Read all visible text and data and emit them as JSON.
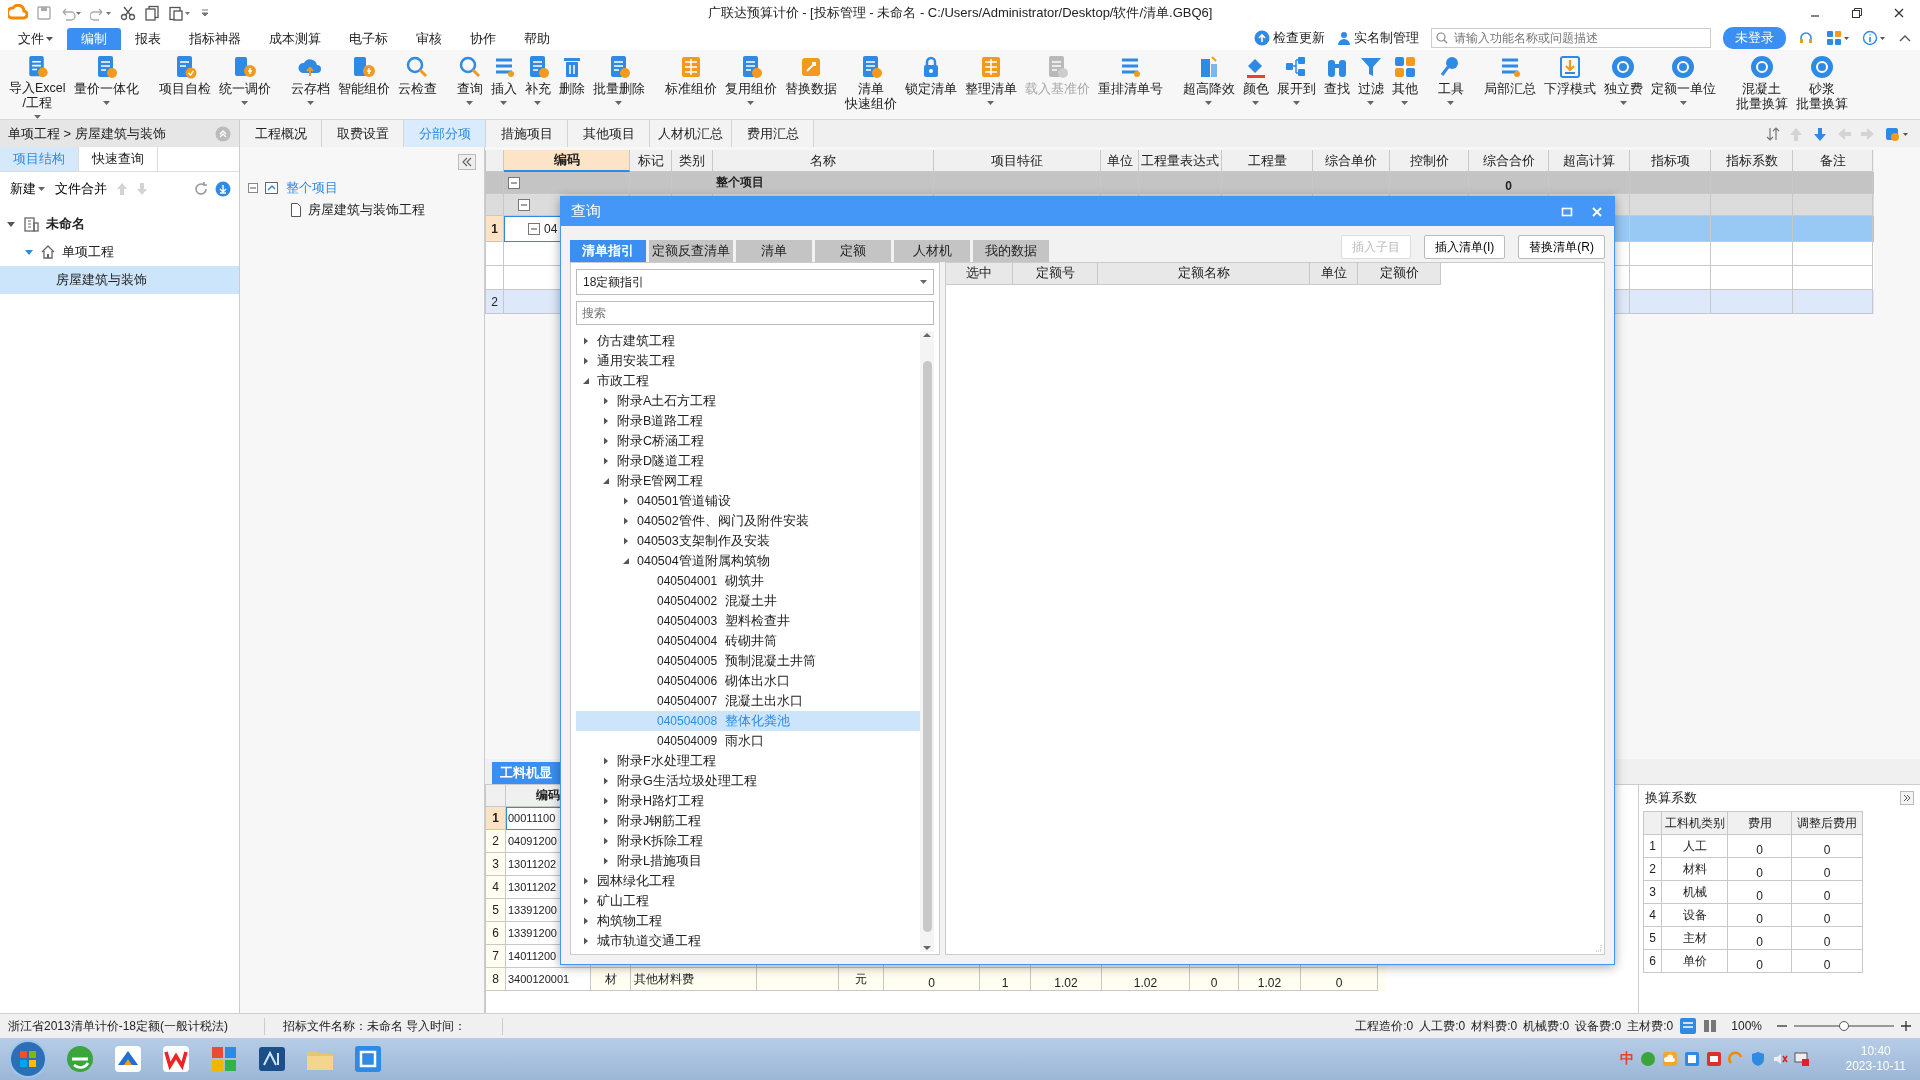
{
  "title_bar": {
    "title": "广联达预算计价 - [投标管理 - 未命名 - C:/Users/Administrator/Desktop/软件/清单.GBQ6]"
  },
  "menu": [
    {
      "label": "文件",
      "dropdown": true,
      "selected": false
    },
    {
      "label": "编制",
      "dropdown": false,
      "selected": true
    },
    {
      "label": "报表",
      "dropdown": false,
      "selected": false
    },
    {
      "label": "指标神器",
      "dropdown": false,
      "selected": false
    },
    {
      "label": "成本测算",
      "dropdown": false,
      "selected": false
    },
    {
      "label": "电子标",
      "dropdown": false,
      "selected": false
    },
    {
      "label": "审核",
      "dropdown": false,
      "selected": false
    },
    {
      "label": "协作",
      "dropdown": false,
      "selected": false
    },
    {
      "label": "帮助",
      "dropdown": false,
      "selected": false
    }
  ],
  "menu_right": {
    "update": "检查更新",
    "realname": "实名制管理",
    "search_placeholder": "请输入功能名称或问题描述",
    "login": "未登录"
  },
  "ribbon": [
    {
      "items": [
        {
          "lines": [
            "导入Excel",
            "/工程"
          ],
          "dropdown": true,
          "disabled": false
        },
        {
          "lines": [
            "量价一体化"
          ],
          "dropdown": true,
          "disabled": false
        }
      ]
    },
    {
      "items": [
        {
          "lines": [
            "项目自检"
          ],
          "dropdown": false,
          "disabled": false
        },
        {
          "lines": [
            "统一调价"
          ],
          "dropdown": true,
          "disabled": false
        }
      ]
    },
    {
      "items": [
        {
          "lines": [
            "云存档"
          ],
          "dropdown": true,
          "disabled": false
        },
        {
          "lines": [
            "智能组价"
          ],
          "dropdown": false,
          "disabled": false
        },
        {
          "lines": [
            "云检查"
          ],
          "dropdown": false,
          "disabled": false
        }
      ]
    },
    {
      "items": [
        {
          "lines": [
            "查询"
          ],
          "dropdown": true,
          "disabled": false
        },
        {
          "lines": [
            "插入"
          ],
          "dropdown": true,
          "disabled": false
        },
        {
          "lines": [
            "补充"
          ],
          "dropdown": true,
          "disabled": false
        },
        {
          "lines": [
            "删除"
          ],
          "dropdown": false,
          "disabled": false
        },
        {
          "lines": [
            "批量删除"
          ],
          "dropdown": true,
          "disabled": false
        }
      ]
    },
    {
      "items": [
        {
          "lines": [
            "标准组价"
          ],
          "dropdown": false,
          "disabled": false
        },
        {
          "lines": [
            "复用组价"
          ],
          "dropdown": true,
          "disabled": false
        },
        {
          "lines": [
            "替换数据"
          ],
          "dropdown": false,
          "disabled": false
        },
        {
          "lines": [
            "清单",
            "快速组价"
          ],
          "dropdown": false,
          "disabled": false
        },
        {
          "lines": [
            "锁定清单"
          ],
          "dropdown": false,
          "disabled": false
        },
        {
          "lines": [
            "整理清单"
          ],
          "dropdown": true,
          "disabled": false
        },
        {
          "lines": [
            "载入基准价"
          ],
          "dropdown": false,
          "disabled": true
        },
        {
          "lines": [
            "重排清单号"
          ],
          "dropdown": false,
          "disabled": false
        }
      ]
    },
    {
      "items": [
        {
          "lines": [
            "超高降效"
          ],
          "dropdown": true,
          "disabled": false
        },
        {
          "lines": [
            "颜色"
          ],
          "dropdown": true,
          "disabled": false
        },
        {
          "lines": [
            "展开到"
          ],
          "dropdown": true,
          "disabled": false
        },
        {
          "lines": [
            "查找"
          ],
          "dropdown": false,
          "disabled": false
        },
        {
          "lines": [
            "过滤"
          ],
          "dropdown": true,
          "disabled": false
        },
        {
          "lines": [
            "其他"
          ],
          "dropdown": true,
          "disabled": false
        }
      ]
    },
    {
      "items": [
        {
          "lines": [
            "工具"
          ],
          "dropdown": true,
          "disabled": false
        }
      ]
    },
    {
      "items": [
        {
          "lines": [
            "局部汇总"
          ],
          "dropdown": false,
          "disabled": false
        },
        {
          "lines": [
            "下浮模式"
          ],
          "dropdown": false,
          "disabled": false
        },
        {
          "lines": [
            "独立费"
          ],
          "dropdown": true,
          "disabled": false
        },
        {
          "lines": [
            "定额一单位"
          ],
          "dropdown": true,
          "disabled": false
        }
      ]
    },
    {
      "items": [
        {
          "lines": [
            "混凝土",
            "批量换算"
          ],
          "dropdown": false,
          "disabled": false
        },
        {
          "lines": [
            "砂浆",
            "批量换算"
          ],
          "dropdown": false,
          "disabled": false
        }
      ]
    }
  ],
  "left_panel": {
    "breadcrumb": "单项工程 > 房屋建筑与装饰",
    "tabs": [
      {
        "label": "项目结构",
        "selected": true
      },
      {
        "label": "快速查询",
        "selected": false
      }
    ],
    "toolbar": {
      "new": "新建",
      "merge": "文件合并"
    },
    "tree": [
      {
        "label": "未命名",
        "expanded": true,
        "children": [
          {
            "label": "单项工程",
            "expanded": true,
            "children": [
              {
                "label": "房屋建筑与装饰",
                "selected": true
              }
            ]
          }
        ]
      }
    ]
  },
  "doc_tabs": [
    {
      "label": "工程概况",
      "selected": false
    },
    {
      "label": "取费设置",
      "selected": false
    },
    {
      "label": "分部分项",
      "selected": true
    },
    {
      "label": "措施项目",
      "selected": false
    },
    {
      "label": "其他项目",
      "selected": false
    },
    {
      "label": "人材机汇总",
      "selected": false
    },
    {
      "label": "费用汇总",
      "selected": false
    }
  ],
  "sub_panel": {
    "tree": [
      {
        "label": "整个项目",
        "expanded": true,
        "children": [
          {
            "label": "房屋建筑与装饰工程"
          }
        ]
      }
    ]
  },
  "main_table": {
    "columns": [
      "编码",
      "标记",
      "类别",
      "名称",
      "项目特征",
      "单位",
      "工程量表达式",
      "工程量",
      "综合单价",
      "控制价",
      "综合合价",
      "超高计算",
      "指标项",
      "指标系数",
      "备注"
    ],
    "rows": [
      {
        "kind": "total",
        "expanded": true,
        "title": "整个项目",
        "amount": "0",
        "selected": false
      },
      {
        "kind": "section",
        "expanded": true,
        "selected": false
      },
      {
        "kind": "item",
        "number": "1",
        "code": "04",
        "expanded": true,
        "selected": true
      },
      {
        "kind": "child",
        "selected": false
      },
      {
        "kind": "child",
        "selected": false
      },
      {
        "kind": "measure",
        "number": "2",
        "selected": false
      }
    ]
  },
  "bottom_panel": {
    "tab": "工料机显",
    "code_header": "编码",
    "rows": [
      {
        "number": "1",
        "code": "00011100",
        "selected": true
      },
      {
        "number": "2",
        "code": "04091200",
        "selected": false
      },
      {
        "number": "3",
        "code": "13011202",
        "selected": false
      },
      {
        "number": "4",
        "code": "13011202",
        "selected": false
      },
      {
        "number": "5",
        "code": "13391200",
        "selected": false
      },
      {
        "number": "6",
        "code": "13391200",
        "selected": false
      },
      {
        "number": "7",
        "code": "14011200",
        "selected": false
      },
      {
        "number": "8",
        "code": "3400120001",
        "type": "材",
        "name": "其他材料费",
        "unit": "元",
        "values": [
          "0",
          "1",
          "1.02",
          "1.02",
          "0",
          "1.02",
          "0"
        ],
        "selected": false
      }
    ]
  },
  "conversion_panel": {
    "title": "换算系数",
    "columns": [
      "工料机类别",
      "费用",
      "调整后费用"
    ],
    "rows": [
      {
        "number": "1",
        "category": "人工",
        "cost": "0",
        "adjusted": "0"
      },
      {
        "number": "2",
        "category": "材料",
        "cost": "0",
        "adjusted": "0"
      },
      {
        "number": "3",
        "category": "机械",
        "cost": "0",
        "adjusted": "0"
      },
      {
        "number": "4",
        "category": "设备",
        "cost": "0",
        "adjusted": "0"
      },
      {
        "number": "5",
        "category": "主材",
        "cost": "0",
        "adjusted": "0"
      },
      {
        "number": "6",
        "category": "单价",
        "cost": "0",
        "adjusted": "0"
      }
    ]
  },
  "dialog": {
    "title": "查询",
    "tabs": [
      {
        "label": "清单指引",
        "selected": true
      },
      {
        "label": "定额反查清单",
        "selected": false
      },
      {
        "label": "清单",
        "selected": false
      },
      {
        "label": "定额",
        "selected": false
      },
      {
        "label": "人材机",
        "selected": false
      },
      {
        "label": "我的数据",
        "selected": false
      }
    ],
    "buttons": [
      {
        "label": "插入子目",
        "disabled": true
      },
      {
        "label": "插入清单(I)",
        "disabled": false
      },
      {
        "label": "替换清单(R)",
        "disabled": false
      }
    ],
    "library": "18定额指引",
    "search_placeholder": "搜索",
    "tree": [
      {
        "label": "仿古建筑工程",
        "expanded": false
      },
      {
        "label": "通用安装工程",
        "expanded": false
      },
      {
        "label": "市政工程",
        "expanded": true,
        "children": [
          {
            "label": "附录A土石方工程",
            "expanded": false
          },
          {
            "label": "附录B道路工程",
            "expanded": false
          },
          {
            "label": "附录C桥涵工程",
            "expanded": false
          },
          {
            "label": "附录D隧道工程",
            "expanded": false
          },
          {
            "label": "附录E管网工程",
            "expanded": true,
            "children": [
              {
                "label": "040501管道铺设",
                "expanded": false
              },
              {
                "label": "040502管件、阀门及附件安装",
                "expanded": false
              },
              {
                "label": "040503支架制作及安装",
                "expanded": false
              },
              {
                "label": "040504管道附属构筑物",
                "expanded": true,
                "children": [
                  {
                    "code": "040504001",
                    "label": "砌筑井",
                    "selected": false
                  },
                  {
                    "code": "040504002",
                    "label": "混凝土井",
                    "selected": false
                  },
                  {
                    "code": "040504003",
                    "label": "塑料检查井",
                    "selected": false
                  },
                  {
                    "code": "040504004",
                    "label": "砖砌井筒",
                    "selected": false
                  },
                  {
                    "code": "040504005",
                    "label": "预制混凝土井筒",
                    "selected": false
                  },
                  {
                    "code": "040504006",
                    "label": "砌体出水口",
                    "selected": false
                  },
                  {
                    "code": "040504007",
                    "label": "混凝土出水口",
                    "selected": false
                  },
                  {
                    "code": "040504008",
                    "label": "整体化粪池",
                    "selected": true
                  },
                  {
                    "code": "040504009",
                    "label": "雨水口",
                    "selected": false
                  }
                ]
              }
            ]
          },
          {
            "label": "附录F水处理工程",
            "expanded": false
          },
          {
            "label": "附录G生活垃圾处理工程",
            "expanded": false
          },
          {
            "label": "附录H路灯工程",
            "expanded": false
          },
          {
            "label": "附录J钢筋工程",
            "expanded": false
          },
          {
            "label": "附录K拆除工程",
            "expanded": false
          },
          {
            "label": "附录L措施项目",
            "expanded": false
          }
        ]
      },
      {
        "label": "园林绿化工程",
        "expanded": false
      },
      {
        "label": "矿山工程",
        "expanded": false
      },
      {
        "label": "构筑物工程",
        "expanded": false
      },
      {
        "label": "城市轨道交通工程",
        "expanded": false
      }
    ],
    "columns": [
      "选中",
      "定额号",
      "定额名称",
      "单位",
      "定额价"
    ]
  },
  "status_bar": {
    "standard": "浙江省2013清单计价-18定额(一般计税法)",
    "file_info": "招标文件名称：未命名 导入时间：",
    "totals": [
      "工程造价:0",
      "人工费:0",
      "材料费:0",
      "机械费:0",
      "设备费:0",
      "主材费:0"
    ],
    "zoom": "100%",
    "zoom_slider": {
      "level": 0.5
    }
  },
  "taskbar": {
    "ime": "中",
    "time": "10:40",
    "date": "2023-10-11"
  }
}
